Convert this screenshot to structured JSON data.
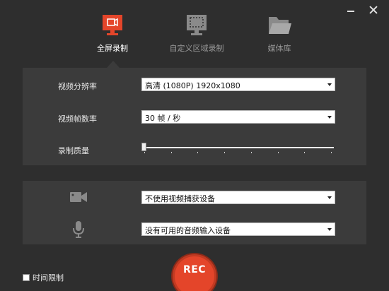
{
  "tabs": [
    {
      "label": "全屏录制",
      "icon": "monitor-camera-icon",
      "active": true
    },
    {
      "label": "自定义区域录制",
      "icon": "monitor-region-icon",
      "active": false
    },
    {
      "label": "媒体库",
      "icon": "folder-icon",
      "active": false
    }
  ],
  "video": {
    "resolution_label": "视频分辨率",
    "resolution_value": "高清 (1080P)   1920x1080",
    "framerate_label": "视频帧数率",
    "framerate_value": "30 帧 / 秒",
    "quality_label": "录制质量",
    "quality_level": 0
  },
  "devices": {
    "camera_icon": "video-camera-icon",
    "camera_value": "不使用视频捕获设备",
    "mic_icon": "microphone-icon",
    "mic_value": "没有可用的音频输入设备"
  },
  "footer": {
    "time_limit_label": "时间限制",
    "time_limit_checked": false,
    "rec_label": "REC"
  },
  "colors": {
    "accent": "#e4452a",
    "background": "#2e2e2e",
    "panel": "#3b3b3b",
    "inactive_icon": "#8a8a8a"
  }
}
